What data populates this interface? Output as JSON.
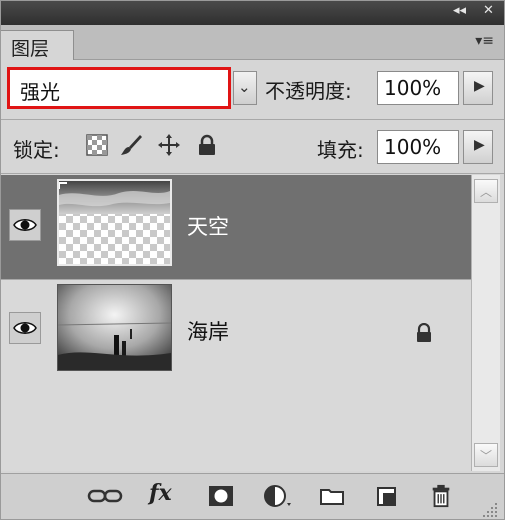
{
  "window": {
    "collapse_glyph": "◂◂",
    "close_glyph": "✕"
  },
  "panel": {
    "tab_label": "图层",
    "menu_glyph": "▾≡"
  },
  "blend": {
    "mode": "强光",
    "dropdown_glyph": "⌄"
  },
  "opacity": {
    "label": "不透明度:",
    "value": "100%"
  },
  "lock": {
    "label": "锁定:"
  },
  "fill": {
    "label": "填充:",
    "value": "100%"
  },
  "layers": [
    {
      "name": "天空",
      "selected": true,
      "visible": true,
      "locked": false
    },
    {
      "name": "海岸",
      "selected": false,
      "visible": true,
      "locked": true
    }
  ],
  "bottom_icons": [
    "link-layers-icon",
    "fx-icon",
    "layer-mask-icon",
    "adjustment-layer-icon",
    "new-group-icon",
    "new-layer-icon",
    "trash-icon"
  ],
  "fx_label": "fx",
  "colors": {
    "selected_layer_bg": "#707070",
    "blend_highlight_border": "#e01414"
  }
}
